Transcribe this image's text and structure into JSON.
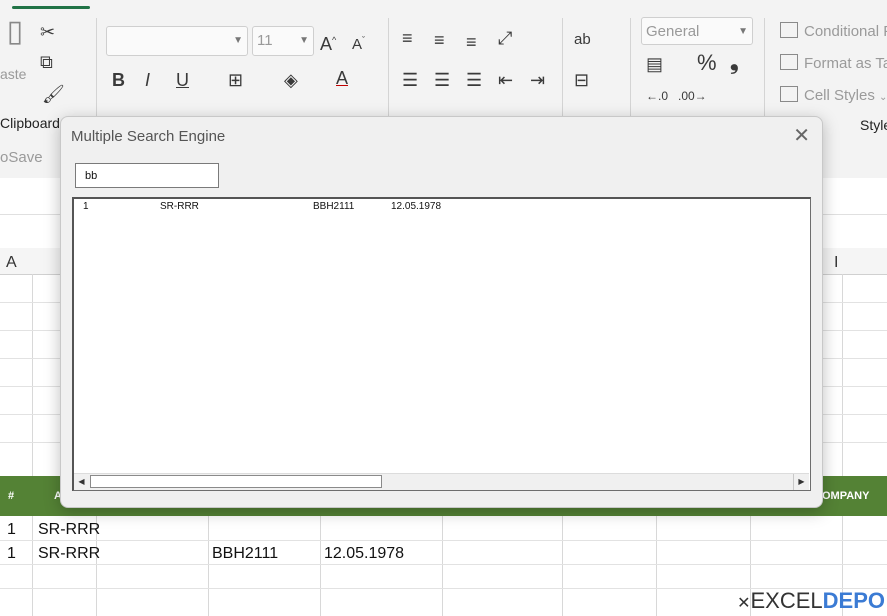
{
  "ribbon": {
    "clipboard_label": "Clipboard",
    "paste_label": "aste",
    "font_name": "",
    "font_size": "11",
    "number_format": "General",
    "styles": {
      "conditional": "Conditional F",
      "format_as": "Format as Ta",
      "cell_styles": "Cell Styles",
      "group_label": "Style"
    }
  },
  "sheet": {
    "autosave_label": "oSave",
    "col_a": "A",
    "col_i": "I",
    "green_header": {
      "hash": "#",
      "a": "A",
      "company": "OMPANY"
    },
    "rows": [
      {
        "num": "1",
        "code": "SR-RRR",
        "plate": "",
        "date": ""
      },
      {
        "num": "1",
        "code": "SR-RRR",
        "plate": "BBH2111",
        "date": "12.05.1978"
      }
    ]
  },
  "dialog": {
    "title": "Multiple Search Engine",
    "search_value": "bb",
    "results": [
      {
        "num": "1",
        "code": "SR-RRR",
        "plate": "BBH2111",
        "date": "12.05.1978"
      }
    ]
  },
  "logo": {
    "part1": "EXCEL",
    "part2": "DEPO"
  },
  "colors": {
    "accent_green": "#217346",
    "header_green": "#548235"
  }
}
